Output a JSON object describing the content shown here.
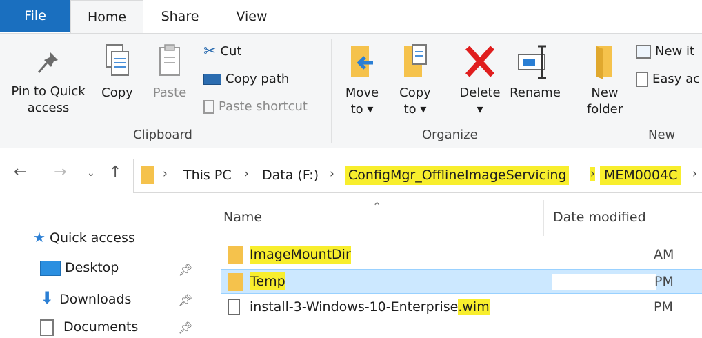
{
  "tabs": {
    "file": "File",
    "home": "Home",
    "share": "Share",
    "view": "View"
  },
  "ribbon": {
    "clipboard": {
      "label": "Clipboard",
      "pin_line1": "Pin to Quick",
      "pin_line2": "access",
      "copy": "Copy",
      "paste": "Paste",
      "cut": "Cut",
      "copy_path": "Copy path",
      "paste_shortcut": "Paste shortcut"
    },
    "organize": {
      "label": "Organize",
      "move_line1": "Move",
      "move_line2": "to ▾",
      "copyto_line1": "Copy",
      "copyto_line2": "to ▾",
      "delete_line1": "Delete",
      "delete_line2": "▾",
      "rename": "Rename"
    },
    "new": {
      "label": "New",
      "folder_line1": "New",
      "folder_line2": "folder",
      "new_item": "New it",
      "easy_access": "Easy ac"
    }
  },
  "address": {
    "crumbs": [
      "This PC",
      "Data (F:)",
      "ConfigMgr_OfflineImageServicing",
      "MEM0004C"
    ]
  },
  "nav": {
    "quick_access": "Quick access",
    "desktop": "Desktop",
    "downloads": "Downloads",
    "documents": "Documents"
  },
  "columns": {
    "name": "Name",
    "date": "Date modified"
  },
  "files": [
    {
      "name": "ImageMountDir",
      "date": "AM",
      "type": "folder"
    },
    {
      "name": "Temp",
      "date": "PM",
      "type": "folder"
    },
    {
      "name_base": "install-3-Windows-10-Enterprise",
      "name_ext": ".wim",
      "date": "PM",
      "type": "file"
    }
  ],
  "colors": {
    "highlight": "#f8ee2d",
    "file_tab": "#1a6fbf",
    "selection": "#cce8ff"
  }
}
